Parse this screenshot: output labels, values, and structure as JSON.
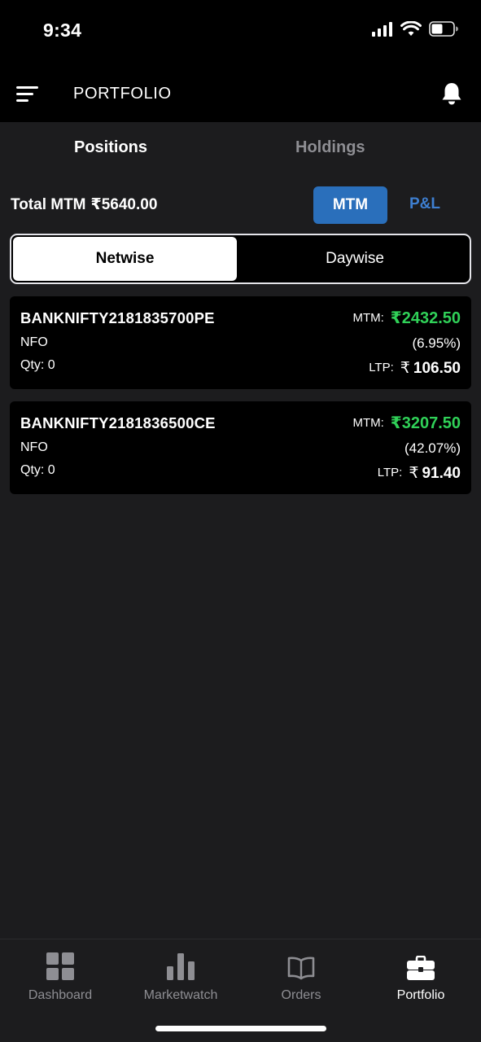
{
  "status_bar": {
    "time": "9:34"
  },
  "header": {
    "title": "PORTFOLIO"
  },
  "tabs": [
    {
      "label": "Positions",
      "active": true
    },
    {
      "label": "Holdings",
      "active": false
    }
  ],
  "summary": {
    "total_mtm_label": "Total MTM",
    "total_mtm_value": "₹5640.00",
    "mtm_button": "MTM",
    "pl_button": "P&L"
  },
  "segment": {
    "netwise": "Netwise",
    "daywise": "Daywise",
    "selected": "Netwise"
  },
  "positions": [
    {
      "symbol": "BANKNIFTY2181835700PE",
      "exchange": "NFO",
      "qty": "Qty: 0",
      "mtm_label": "MTM:",
      "mtm_value": "₹2432.50",
      "percent": "(6.95%)",
      "ltp_label": "LTP:",
      "ltp_currency": "₹",
      "ltp_value": "106.50"
    },
    {
      "symbol": "BANKNIFTY2181836500CE",
      "exchange": "NFO",
      "qty": "Qty: 0",
      "mtm_label": "MTM:",
      "mtm_value": "₹3207.50",
      "percent": "(42.07%)",
      "ltp_label": "LTP:",
      "ltp_currency": "₹",
      "ltp_value": "91.40"
    }
  ],
  "bottom_nav": [
    {
      "label": "Dashboard",
      "icon": "dashboard-grid-icon"
    },
    {
      "label": "Marketwatch",
      "icon": "bar-chart-icon"
    },
    {
      "label": "Orders",
      "icon": "open-book-icon"
    },
    {
      "label": "Portfolio",
      "icon": "briefcase-icon",
      "active": true
    }
  ],
  "colors": {
    "accent_blue": "#2a6fbb",
    "profit_green": "#30d158",
    "background": "#1c1c1e",
    "card": "#000000"
  }
}
